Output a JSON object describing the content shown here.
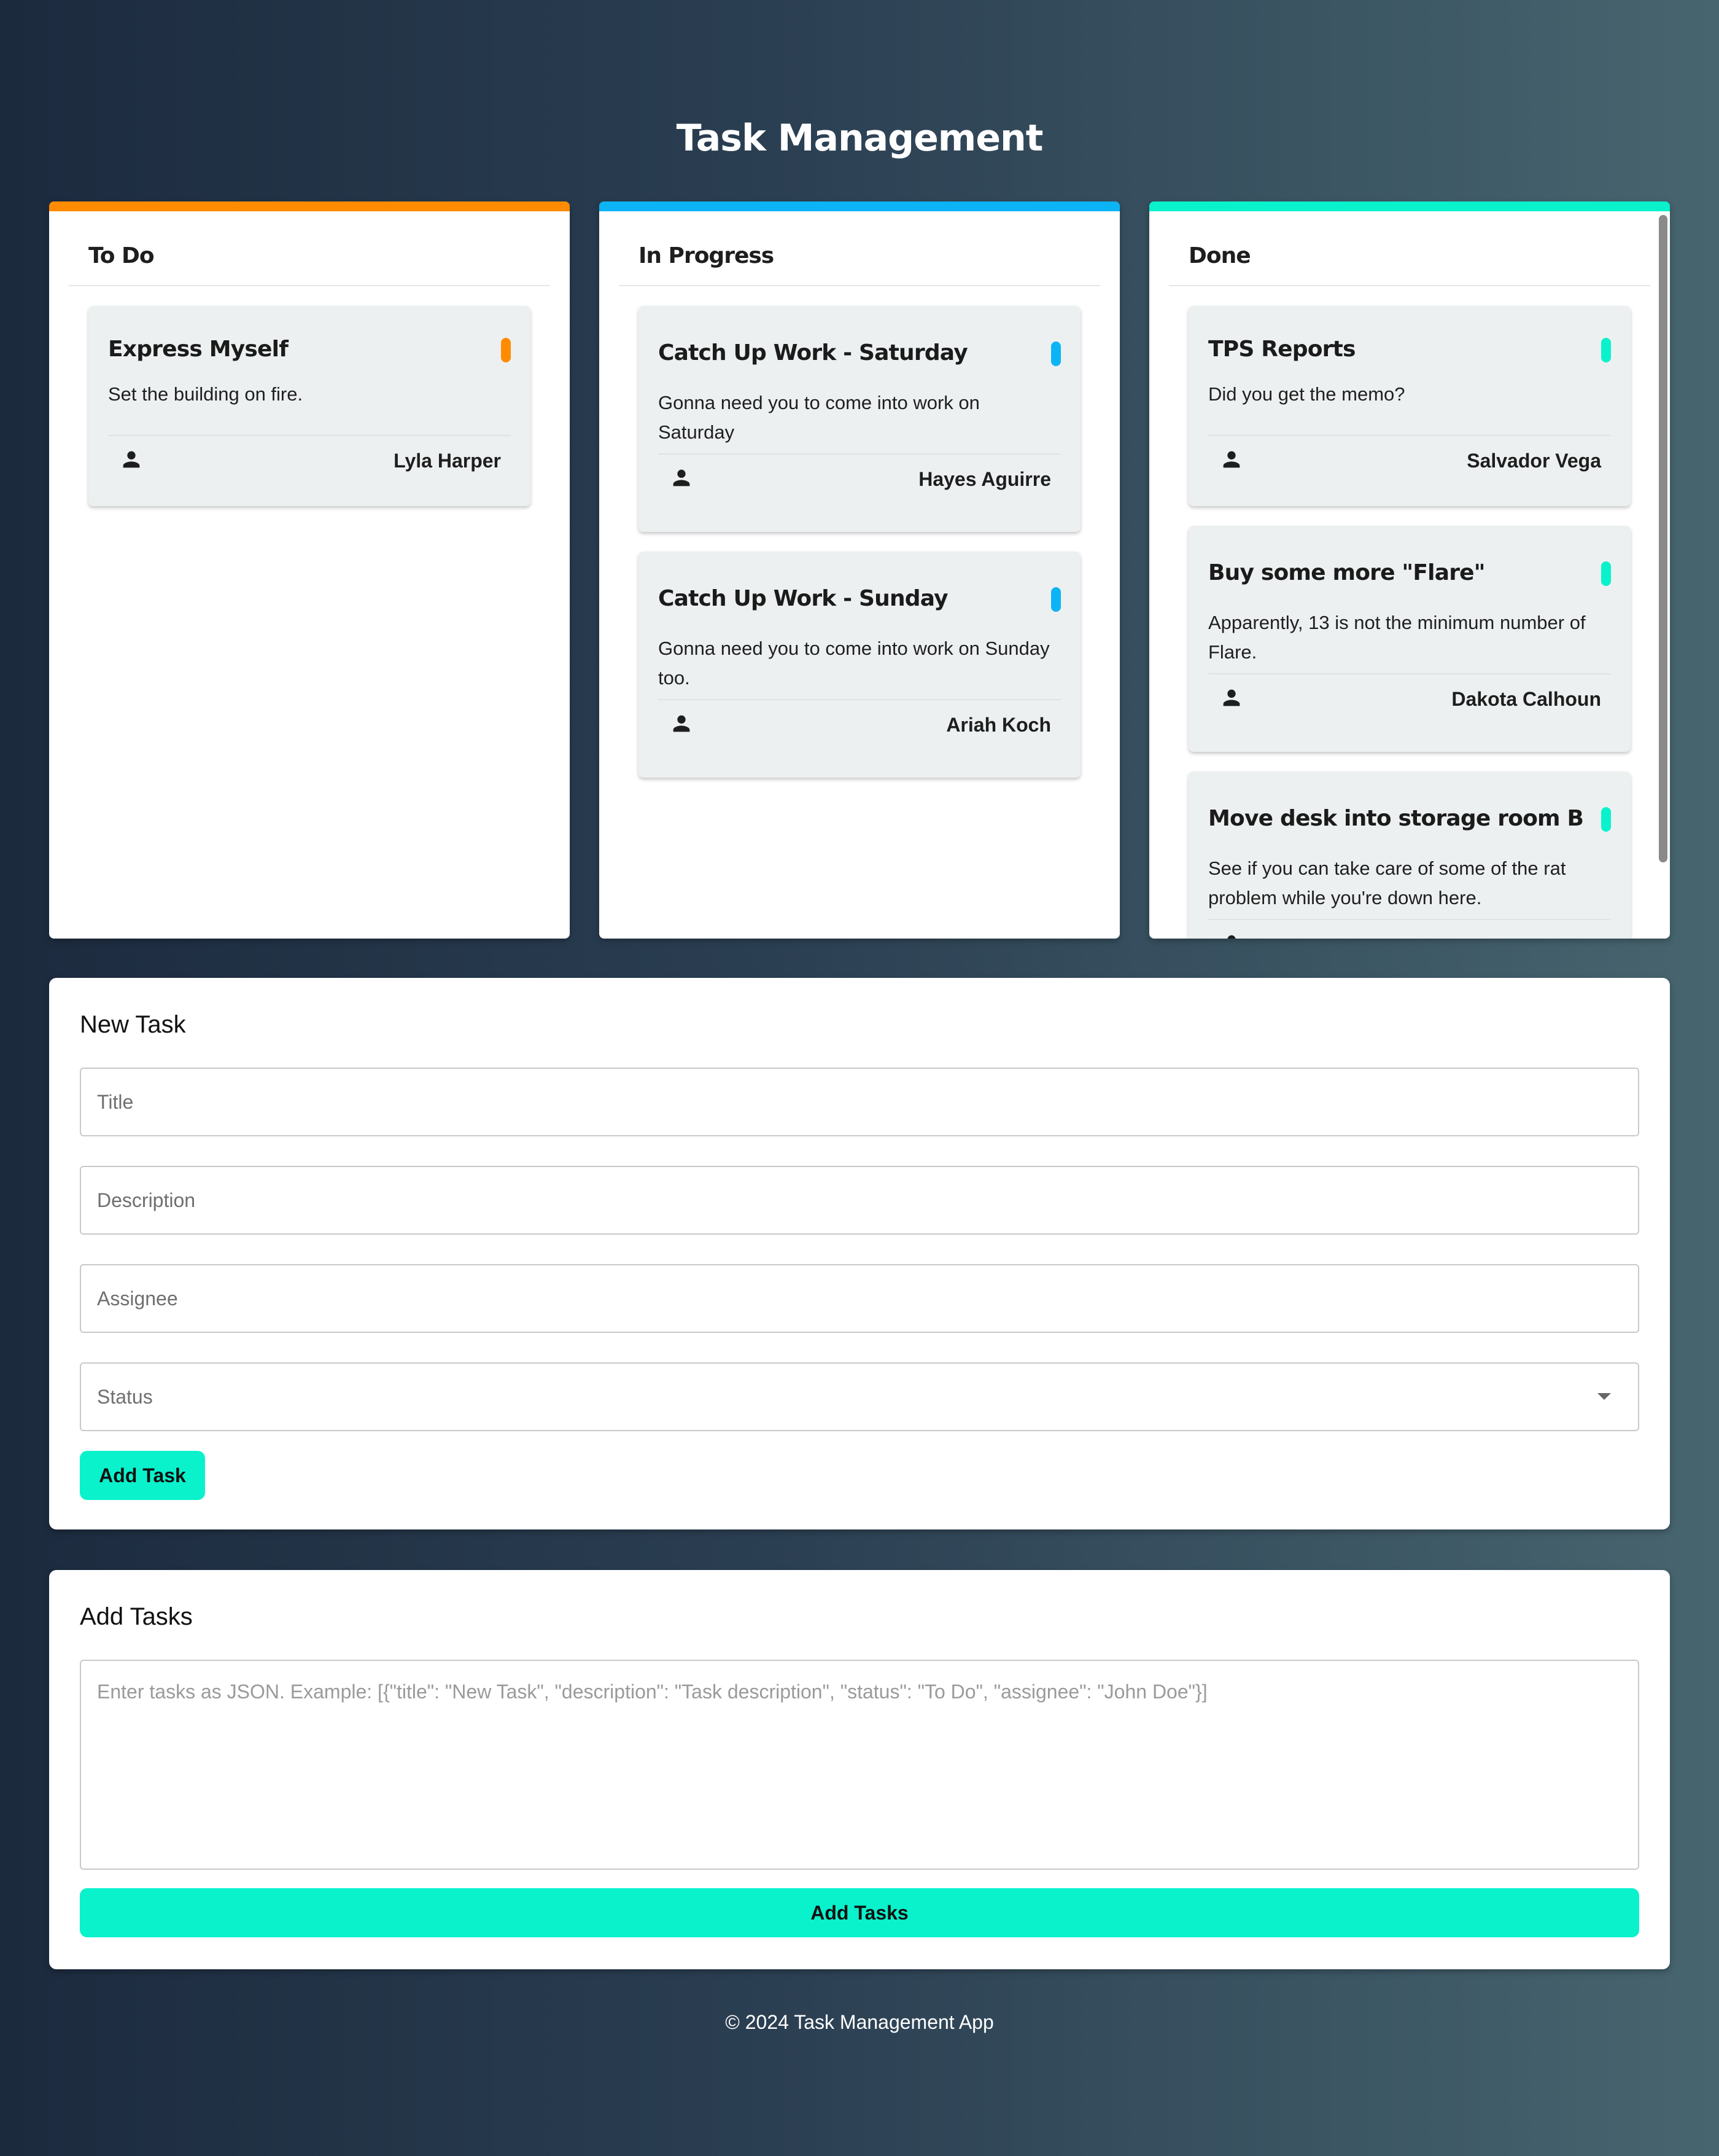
{
  "app": {
    "title": "Task Management"
  },
  "colors": {
    "todo": "#ff8c00",
    "in_progress": "#0cb4f5",
    "done": "#0af2cc",
    "button": "#0af2cc"
  },
  "columns": [
    {
      "title": "To Do",
      "tasks": [
        {
          "title": "Express Myself",
          "description": "Set the building on fire.",
          "assignee": "Lyla Harper",
          "icon": "person-icon"
        }
      ]
    },
    {
      "title": "In Progress",
      "tasks": [
        {
          "title": "Catch Up Work - Saturday",
          "description": "Gonna need you to come into work on Saturday",
          "assignee": "Hayes Aguirre",
          "icon": "person-icon"
        },
        {
          "title": "Catch Up Work - Sunday",
          "description": "Gonna need you to come into work on Sunday too.",
          "assignee": "Ariah Koch",
          "icon": "person-icon"
        }
      ]
    },
    {
      "title": "Done",
      "tasks": [
        {
          "title": "TPS Reports",
          "description": "Did you get the memo?",
          "assignee": "Salvador Vega",
          "icon": "person-icon"
        },
        {
          "title": "Buy some more \"Flare\"",
          "description": "Apparently, 13 is not the minimum number of Flare.",
          "assignee": "Dakota Calhoun",
          "icon": "person-icon"
        },
        {
          "title": "Move desk into storage room B",
          "description": "See if you can take care of some of the rat problem while you're down here.",
          "assignee": "",
          "icon": "person-icon"
        }
      ]
    }
  ],
  "new_task": {
    "heading": "New Task",
    "title_placeholder": "Title",
    "description_placeholder": "Description",
    "assignee_placeholder": "Assignee",
    "status_placeholder": "Status",
    "submit_label": "Add Task"
  },
  "bulk": {
    "heading": "Add Tasks",
    "placeholder": "Enter tasks as JSON. Example: [{\"title\": \"New Task\", \"description\": \"Task description\", \"status\": \"To Do\", \"assignee\": \"John Doe\"}]",
    "submit_label": "Add Tasks"
  },
  "footer": {
    "text": "© 2024 Task Management App"
  }
}
